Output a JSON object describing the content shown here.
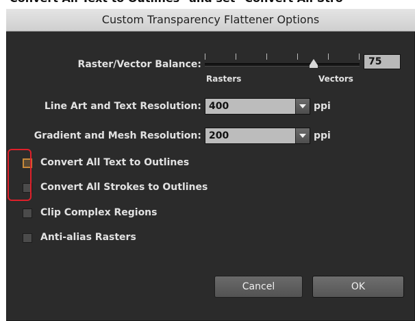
{
  "caption": "Convert All Text to Outlines\" and set \"Convert All Stro",
  "dialog": {
    "title": "Custom Transparency Flattener Options"
  },
  "raster_vector": {
    "label": "Raster/Vector Balance:",
    "value": "75",
    "min_label": "Rasters",
    "max_label": "Vectors"
  },
  "line_art": {
    "label": "Line Art and Text Resolution:",
    "value": "400",
    "unit": "ppi"
  },
  "gradient": {
    "label": "Gradient and Mesh Resolution:",
    "value": "200",
    "unit": "ppi"
  },
  "options": [
    {
      "label": "Convert All Text to Outlines",
      "checked": false
    },
    {
      "label": "Convert All Strokes to Outlines",
      "checked": false
    },
    {
      "label": "Clip Complex Regions",
      "checked": false
    },
    {
      "label": "Anti-alias Rasters",
      "checked": false
    }
  ],
  "buttons": {
    "cancel": "Cancel",
    "ok": "OK"
  },
  "colors": {
    "dialog_bg": "#2b2b2b",
    "highlight": "#e0202a",
    "checkbox_focus": "#c98a3a"
  }
}
